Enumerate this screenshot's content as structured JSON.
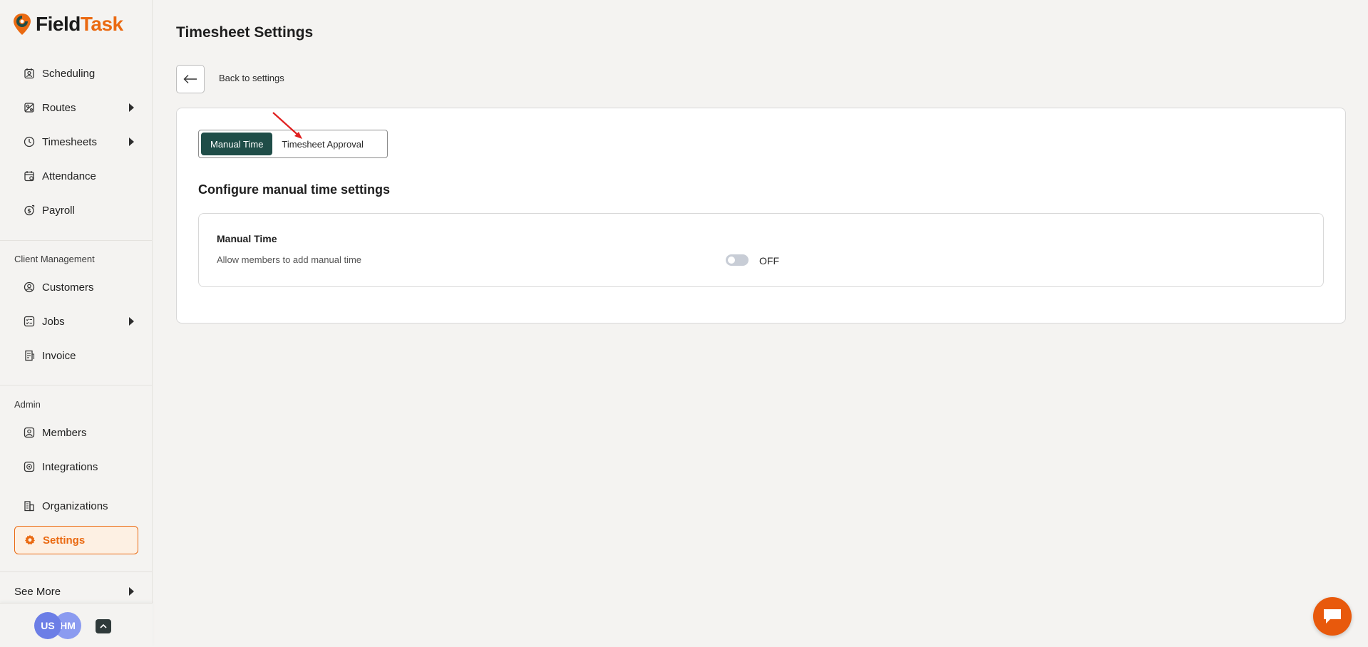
{
  "brand": {
    "name_part1": "Field",
    "name_part2": "Task",
    "accent_color": "#ea6a12",
    "primary_color": "#1f4d48"
  },
  "sidebar": {
    "main_items": [
      {
        "label": "Scheduling",
        "icon": "calendar-user-icon",
        "has_submenu": false
      },
      {
        "label": "Routes",
        "icon": "map-icon",
        "has_submenu": true
      },
      {
        "label": "Timesheets",
        "icon": "clock-icon",
        "has_submenu": true
      },
      {
        "label": "Attendance",
        "icon": "calendar-check-icon",
        "has_submenu": false
      },
      {
        "label": "Payroll",
        "icon": "dollar-icon",
        "has_submenu": false
      }
    ],
    "client_section_label": "Client Management",
    "client_items": [
      {
        "label": "Customers",
        "icon": "user-circle-icon",
        "has_submenu": false
      },
      {
        "label": "Jobs",
        "icon": "checklist-icon",
        "has_submenu": true
      },
      {
        "label": "Invoice",
        "icon": "invoice-icon",
        "has_submenu": false
      }
    ],
    "admin_section_label": "Admin",
    "admin_items": [
      {
        "label": "Members",
        "icon": "user-square-icon",
        "has_submenu": false
      },
      {
        "label": "Integrations",
        "icon": "integration-icon",
        "has_submenu": false
      },
      {
        "label": "Organizations",
        "icon": "building-icon",
        "has_submenu": false
      },
      {
        "label": "Settings",
        "icon": "gear-icon",
        "has_submenu": false,
        "active": true
      }
    ],
    "see_more_label": "See More",
    "avatars": [
      "US",
      "HM"
    ]
  },
  "main": {
    "page_title": "Timesheet Settings",
    "back_label": "Back to settings",
    "tabs": [
      {
        "label": "Manual Time",
        "active": true
      },
      {
        "label": "Timesheet Approval",
        "active": false
      }
    ],
    "section_title": "Configure manual time settings",
    "option": {
      "title": "Manual Time",
      "description": "Allow members to add manual time",
      "toggle_on": false,
      "toggle_label": "OFF"
    }
  }
}
